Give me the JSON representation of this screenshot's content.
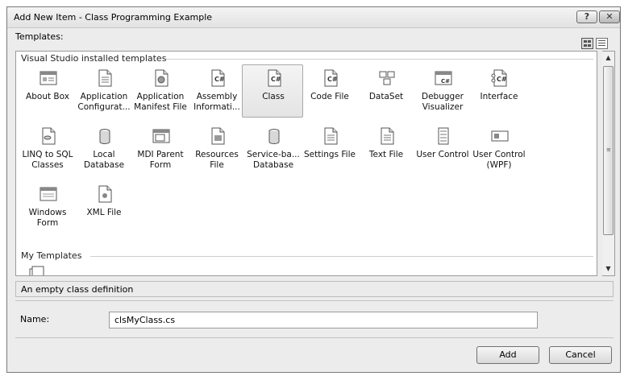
{
  "window": {
    "title": "Add New Item - Class Programming Example",
    "help_label": "?",
    "close_label": "✕"
  },
  "templates_label": "Templates:",
  "view_buttons": [
    {
      "icon": "large-icons-icon"
    },
    {
      "icon": "small-icons-icon"
    }
  ],
  "groups": [
    {
      "header": "Visual Studio installed templates"
    },
    {
      "header": "My Templates"
    }
  ],
  "templates": [
    {
      "caption": "About Box",
      "icon": "about-box-icon"
    },
    {
      "caption": "Application Configurat...",
      "icon": "config-file-icon"
    },
    {
      "caption": "Application Manifest File",
      "icon": "manifest-file-icon"
    },
    {
      "caption": "Assembly Informati...",
      "icon": "assembly-info-icon"
    },
    {
      "caption": "Class",
      "icon": "csharp-class-icon",
      "selected": true
    },
    {
      "caption": "Code File",
      "icon": "code-file-icon"
    },
    {
      "caption": "DataSet",
      "icon": "dataset-icon"
    },
    {
      "caption": "Debugger Visualizer",
      "icon": "debugger-visualizer-icon"
    },
    {
      "caption": "Interface",
      "icon": "interface-icon"
    },
    {
      "caption": "LINQ to SQL Classes",
      "icon": "linq-to-sql-icon"
    },
    {
      "caption": "Local Database",
      "icon": "database-icon"
    },
    {
      "caption": "MDI Parent Form",
      "icon": "mdi-form-icon"
    },
    {
      "caption": "Resources File",
      "icon": "resources-file-icon"
    },
    {
      "caption": "Service-ba... Database",
      "icon": "database-icon"
    },
    {
      "caption": "Settings File",
      "icon": "settings-file-icon"
    },
    {
      "caption": "Text File",
      "icon": "text-file-icon"
    },
    {
      "caption": "User Control",
      "icon": "user-control-icon"
    },
    {
      "caption": "User Control (WPF)",
      "icon": "wpf-user-control-icon"
    },
    {
      "caption": "Windows Form",
      "icon": "windows-form-icon"
    },
    {
      "caption": "XML File",
      "icon": "xml-file-icon"
    }
  ],
  "my_templates": [
    {
      "caption": "",
      "icon": "template-icon"
    }
  ],
  "description": "An empty class definition",
  "name_label": "Name:",
  "name_value": "clsMyClass.cs",
  "buttons": {
    "add": "Add",
    "cancel": "Cancel"
  },
  "scrollbar": {
    "up": "▲",
    "down": "▼",
    "grip": "≡"
  }
}
